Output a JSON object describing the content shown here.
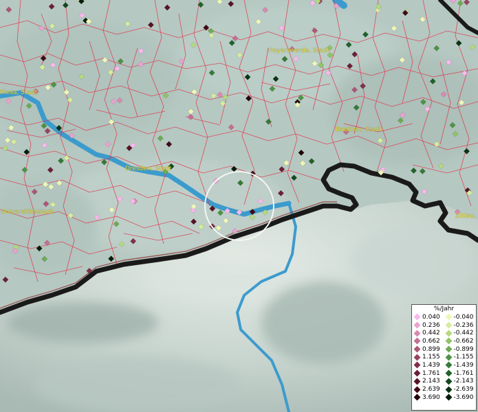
{
  "map": {
    "cities": [
      {
        "id": "riesa",
        "label": "Riesa, Stadt"
      },
      {
        "id": "hoyerswerda",
        "label": "Hoyerswerda, Stadt"
      },
      {
        "id": "dresden",
        "label": "Dresden, Stadt"
      },
      {
        "id": "bautzen",
        "label": "Bautzen, Stadt"
      },
      {
        "id": "universitaetsstadt",
        "label": "Universitätsstadt"
      },
      {
        "id": "zittau",
        "label": "Zittau,"
      }
    ]
  },
  "legend": {
    "title": "%/Jahr",
    "positive": [
      {
        "value": "0.040",
        "color": "#f7b9ec"
      },
      {
        "value": "0.236",
        "color": "#e9a3cf"
      },
      {
        "value": "0.442",
        "color": "#d98ab0"
      },
      {
        "value": "0.662",
        "color": "#c46f93"
      },
      {
        "value": "0.899",
        "color": "#ad5777"
      },
      {
        "value": "1.155",
        "color": "#98435f"
      },
      {
        "value": "1.439",
        "color": "#82304a"
      },
      {
        "value": "1.761",
        "color": "#6c2036"
      },
      {
        "value": "2.143",
        "color": "#561424"
      },
      {
        "value": "2.639",
        "color": "#3e0b16"
      },
      {
        "value": "3.690",
        "color": "#22040a"
      }
    ],
    "negative": [
      {
        "value": "-0.040",
        "color": "#eef6b8"
      },
      {
        "value": "-0.236",
        "color": "#d6ec9e"
      },
      {
        "value": "-0.442",
        "color": "#b4d97f"
      },
      {
        "value": "-0.662",
        "color": "#8fc468"
      },
      {
        "value": "-0.899",
        "color": "#6dab55"
      },
      {
        "value": "-1.155",
        "color": "#4e9345"
      },
      {
        "value": "-1.439",
        "color": "#357a37"
      },
      {
        "value": "-1.761",
        "color": "#20622a"
      },
      {
        "value": "-2.143",
        "color": "#114a1e"
      },
      {
        "value": "-2.639",
        "color": "#083514"
      },
      {
        "value": "-3.690",
        "color": "#021d08"
      }
    ]
  }
}
